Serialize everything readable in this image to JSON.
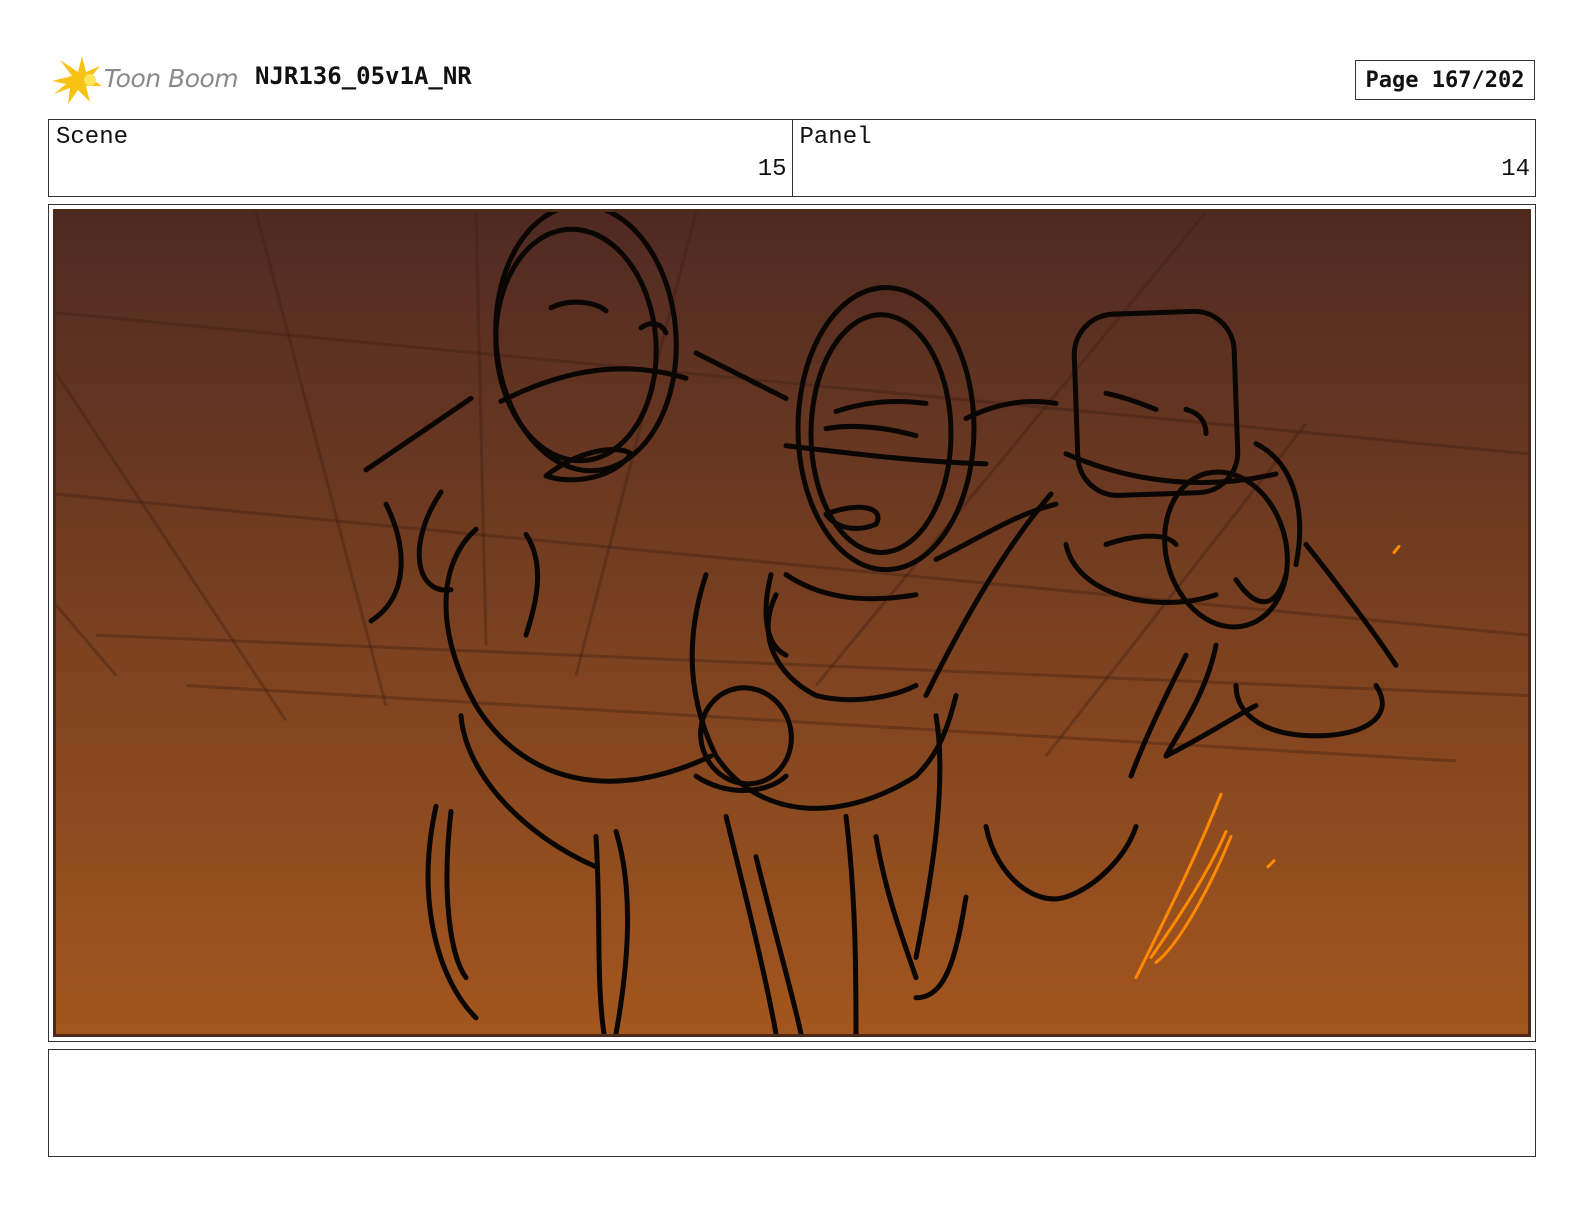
{
  "header": {
    "logo_text": "Toon Boom",
    "project_title": "NJR136_05v1A_NR",
    "page_label": "Page 167/202"
  },
  "info": {
    "scene_label": "Scene",
    "scene_value": "15",
    "panel_label": "Panel",
    "panel_value": "14"
  },
  "frame": {
    "gradient_top": "#4f2a22",
    "gradient_bottom": "#a3561e",
    "line_color": "#0a0604",
    "accent_stroke": "#ff8a00"
  },
  "notes": {
    "text": ""
  }
}
